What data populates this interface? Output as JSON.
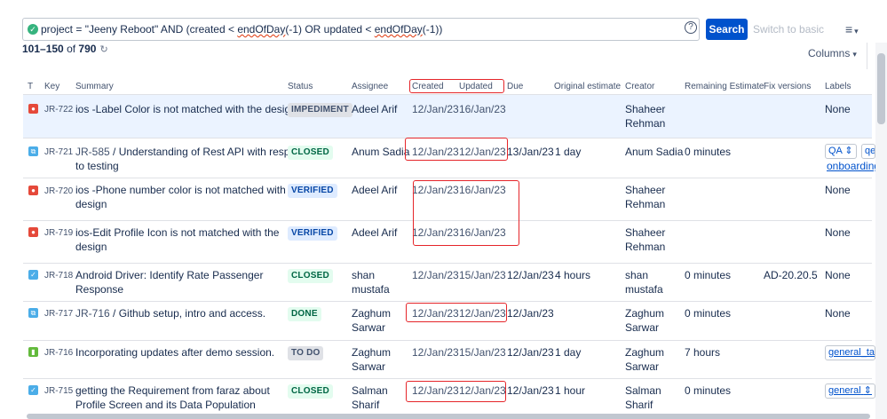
{
  "jql": {
    "part1": "project = \"Jeeny Reboot\" AND (created < ",
    "fn1": "endOfDay",
    "part2": "(-1) OR updated < ",
    "fn2": "endOfDay",
    "part3": "(-1))"
  },
  "toolbar": {
    "help_icon": "?",
    "search_label": "Search",
    "switch_label": "Switch to basic",
    "menu_icon": "≡",
    "columns_label": "Columns"
  },
  "results": {
    "range": "101–150",
    "of_label": "of",
    "total": "790"
  },
  "columns": {
    "t": "T",
    "key": "Key",
    "summary": "Summary",
    "status": "Status",
    "assignee": "Assignee",
    "created": "Created",
    "updated": "Updated",
    "due": "Due",
    "original_estimate": "Original estimate",
    "creator": "Creator",
    "remaining_estimate": "Remaining Estimate",
    "fix_versions": "Fix versions",
    "labels": "Labels"
  },
  "rows": [
    {
      "key": "JR-722",
      "type": "bug",
      "summary_lines": [
        "ios -Label Color is not matched with the design"
      ],
      "status": "IMPEDIMENT",
      "assignee_lines": [
        "Adeel Arif"
      ],
      "created": "12/Jan/23",
      "updated": "16/Jan/23",
      "due": "",
      "original_estimate": "",
      "creator_lines": [
        "Shaheer",
        "Rehman"
      ],
      "remaining": "",
      "fix_version": "",
      "label_text": "None"
    },
    {
      "key": "JR-721",
      "type": "subtask",
      "parent": "JR-585",
      "summary_lines": [
        "Understanding of Rest API with respect",
        "to testing"
      ],
      "status": "CLOSED",
      "assignee_lines": [
        "Anum Sadia"
      ],
      "created": "12/Jan/23",
      "updated": "12/Jan/23",
      "due": "13/Jan/23",
      "original_estimate": "1 day",
      "creator_lines": [
        "Anum Sadia"
      ],
      "remaining": "0 minutes",
      "fix_version": "",
      "labels": [
        "QA",
        "qe"
      ],
      "label_link": "onboarding"
    },
    {
      "key": "JR-720",
      "type": "bug",
      "summary_lines": [
        "ios -Phone number color is not matched with",
        "design"
      ],
      "status": "VERIFIED",
      "assignee_lines": [
        "Adeel Arif"
      ],
      "created": "12/Jan/23",
      "updated": "16/Jan/23",
      "due": "",
      "original_estimate": "",
      "creator_lines": [
        "Shaheer",
        "Rehman"
      ],
      "remaining": "",
      "fix_version": "",
      "label_text": "None"
    },
    {
      "key": "JR-719",
      "type": "bug",
      "summary_lines": [
        "ios-Edit Profile Icon is not matched with the",
        "design"
      ],
      "status": "VERIFIED",
      "assignee_lines": [
        "Adeel Arif"
      ],
      "created": "12/Jan/23",
      "updated": "16/Jan/23",
      "due": "",
      "original_estimate": "",
      "creator_lines": [
        "Shaheer",
        "Rehman"
      ],
      "remaining": "",
      "fix_version": "",
      "label_text": "None"
    },
    {
      "key": "JR-718",
      "type": "task",
      "summary_lines": [
        "Android Driver: Identify Rate Passenger",
        "Response"
      ],
      "status": "CLOSED",
      "assignee_lines": [
        "shan",
        "mustafa"
      ],
      "created": "12/Jan/23",
      "updated": "15/Jan/23",
      "due": "12/Jan/23",
      "original_estimate": "4 hours",
      "creator_lines": [
        "shan",
        "mustafa"
      ],
      "remaining": "0 minutes",
      "fix_version": "AD-20.20.5",
      "label_text": "None"
    },
    {
      "key": "JR-717",
      "type": "subtask",
      "parent": "JR-716",
      "summary_lines": [
        "Github setup, intro and access."
      ],
      "status": "DONE",
      "assignee_lines": [
        "Zaghum",
        "Sarwar"
      ],
      "created": "12/Jan/23",
      "updated": "12/Jan/23",
      "due": "12/Jan/23",
      "original_estimate": "",
      "creator_lines": [
        "Zaghum",
        "Sarwar"
      ],
      "remaining": "0 minutes",
      "fix_version": "",
      "label_text": "None"
    },
    {
      "key": "JR-716",
      "type": "story",
      "summary_lines": [
        "Incorporating updates after demo session."
      ],
      "status": "TO DO",
      "assignee_lines": [
        "Zaghum",
        "Sarwar"
      ],
      "created": "12/Jan/23",
      "updated": "15/Jan/23",
      "due": "12/Jan/23",
      "original_estimate": "1 day",
      "creator_lines": [
        "Zaghum",
        "Sarwar"
      ],
      "remaining": "7 hours",
      "fix_version": "",
      "labels": [
        "general_tas"
      ]
    },
    {
      "key": "JR-715",
      "type": "task",
      "summary_lines": [
        "getting the Requirement from faraz about",
        "Profile Screen and its Data Population"
      ],
      "status": "CLOSED",
      "assignee_lines": [
        "Salman",
        "Sharif"
      ],
      "created": "12/Jan/23",
      "updated": "12/Jan/23",
      "due": "12/Jan/23",
      "original_estimate": "1 hour",
      "creator_lines": [
        "Salman",
        "Sharif"
      ],
      "remaining": "0 minutes",
      "fix_version": "",
      "labels": [
        "general"
      ]
    }
  ],
  "icons": {
    "bug": "bug-icon",
    "subtask": "subtask-icon",
    "task": "task-icon",
    "story": "story-icon"
  },
  "colors": {
    "accent": "#0052cc",
    "bug": "#e5493a",
    "subtask": "#4bade8",
    "task": "#4bade8",
    "story": "#63ba3c",
    "highlight": "#e5252a"
  }
}
